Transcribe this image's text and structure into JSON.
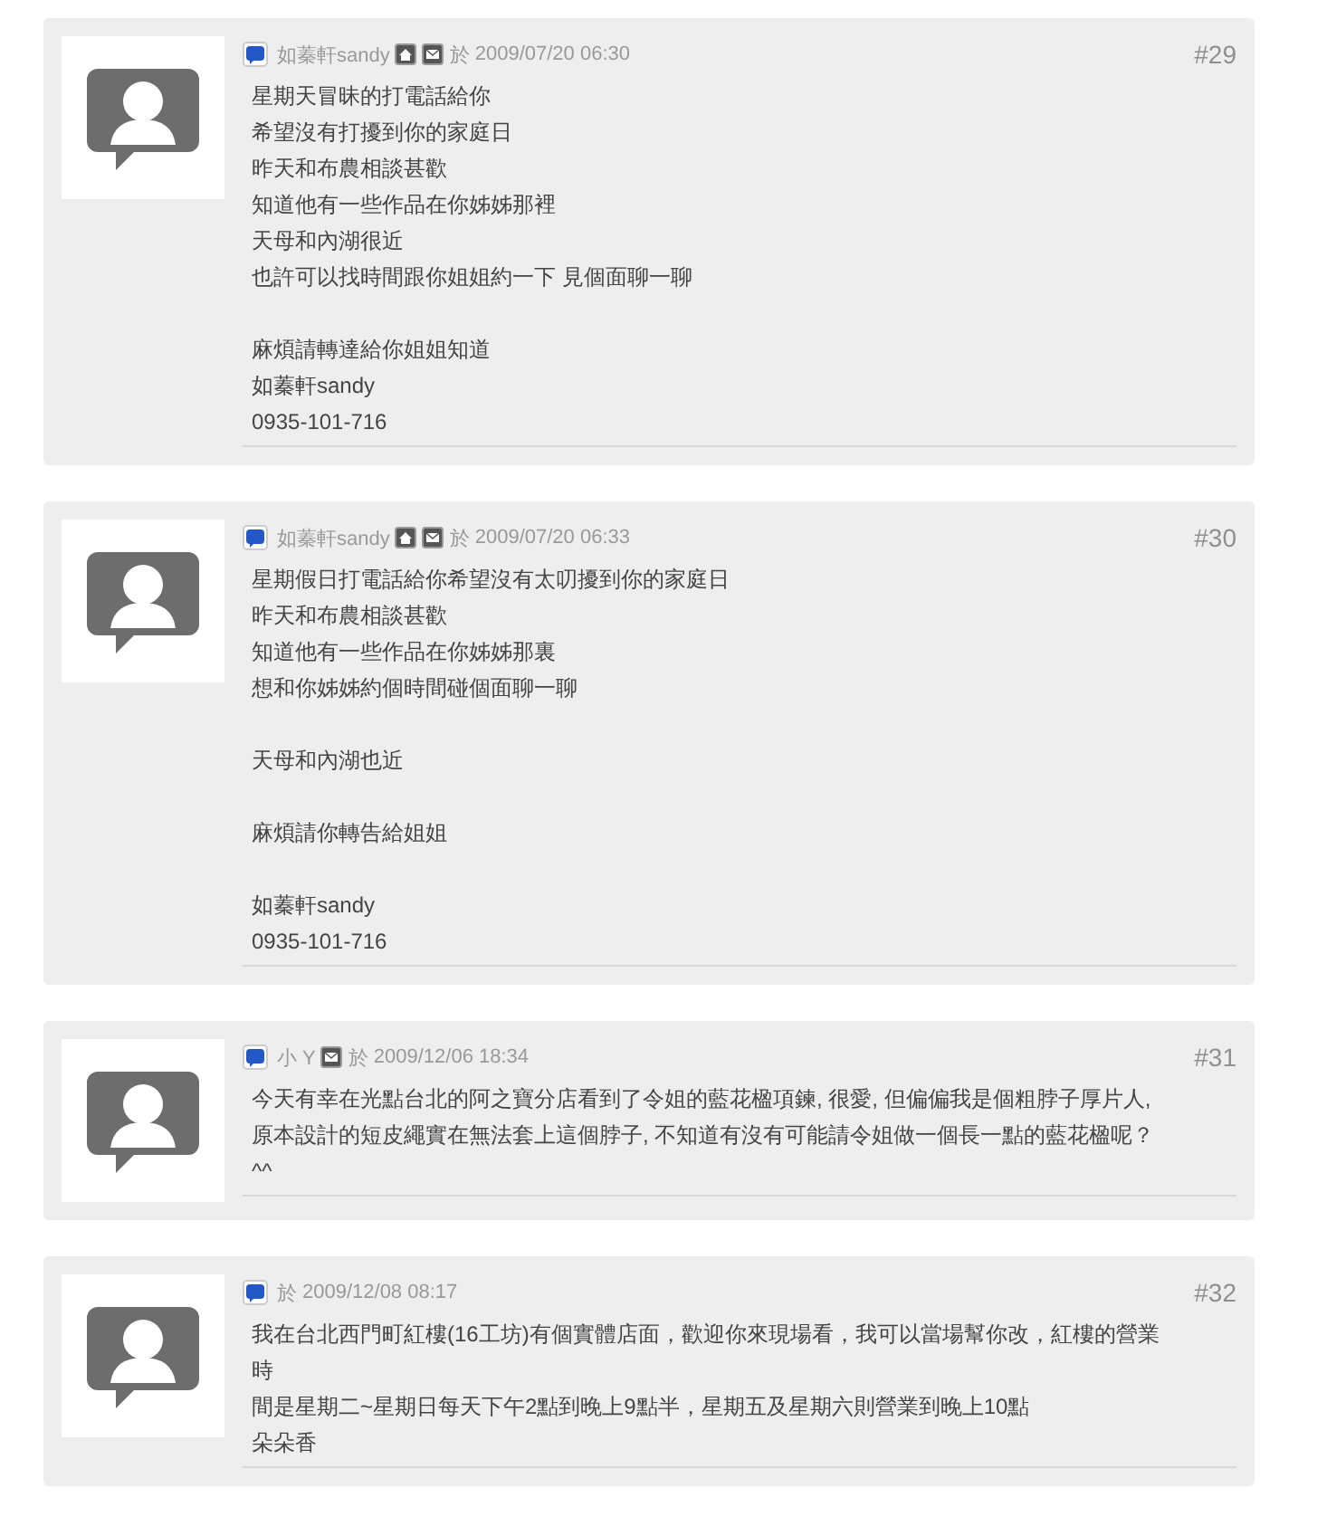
{
  "posts": [
    {
      "author": "如蓁軒sandy",
      "home": true,
      "mail": true,
      "on_label": "於",
      "date": "2009/07/20 06:30",
      "number": "#29",
      "paragraphs": [
        [
          "星期天冒昧的打電話給你",
          "希望沒有打擾到你的家庭日",
          "昨天和布農相談甚歡",
          "知道他有一些作品在你姊姊那裡",
          "天母和內湖很近",
          "也許可以找時間跟你姐姐約一下 見個面聊一聊"
        ],
        [
          "麻煩請轉達給你姐姐知道",
          "如蓁軒sandy",
          "0935-101-716"
        ]
      ]
    },
    {
      "author": "如蓁軒sandy",
      "home": true,
      "mail": true,
      "on_label": "於",
      "date": "2009/07/20 06:33",
      "number": "#30",
      "paragraphs": [
        [
          "星期假日打電話給你希望沒有太叨擾到你的家庭日",
          "昨天和布農相談甚歡",
          "知道他有一些作品在你姊姊那裏",
          "想和你姊姊約個時間碰個面聊一聊"
        ],
        [
          "天母和內湖也近"
        ],
        [
          "麻煩請你轉告給姐姐"
        ],
        [
          "如蓁軒sandy",
          "0935-101-716"
        ]
      ]
    },
    {
      "author": "小 Y",
      "home": false,
      "mail": true,
      "on_label": "於",
      "date": "2009/12/06 18:34",
      "number": "#31",
      "paragraphs": [
        [
          "今天有幸在光點台北的阿之寶分店看到了令姐的藍花楹項鍊, 很愛, 但偏偏我是個粗脖子厚片人, 原本設計的短皮繩實在無法套上這個脖子, 不知道有沒有可能請令姐做一個長一點的藍花楹呢？^^"
        ]
      ]
    },
    {
      "home": false,
      "mail": false,
      "on_label": "於",
      "date": "2009/12/08 08:17",
      "number": "#32",
      "paragraphs": [
        [
          "我在台北西門町紅樓(16工坊)有個實體店面，歡迎你來現場看，我可以當場幫你改，紅樓的營業時",
          "間是星期二~星期日每天下午2點到晚上9點半，星期五及星期六則營業到晚上10點",
          "朵朵香"
        ]
      ]
    }
  ]
}
